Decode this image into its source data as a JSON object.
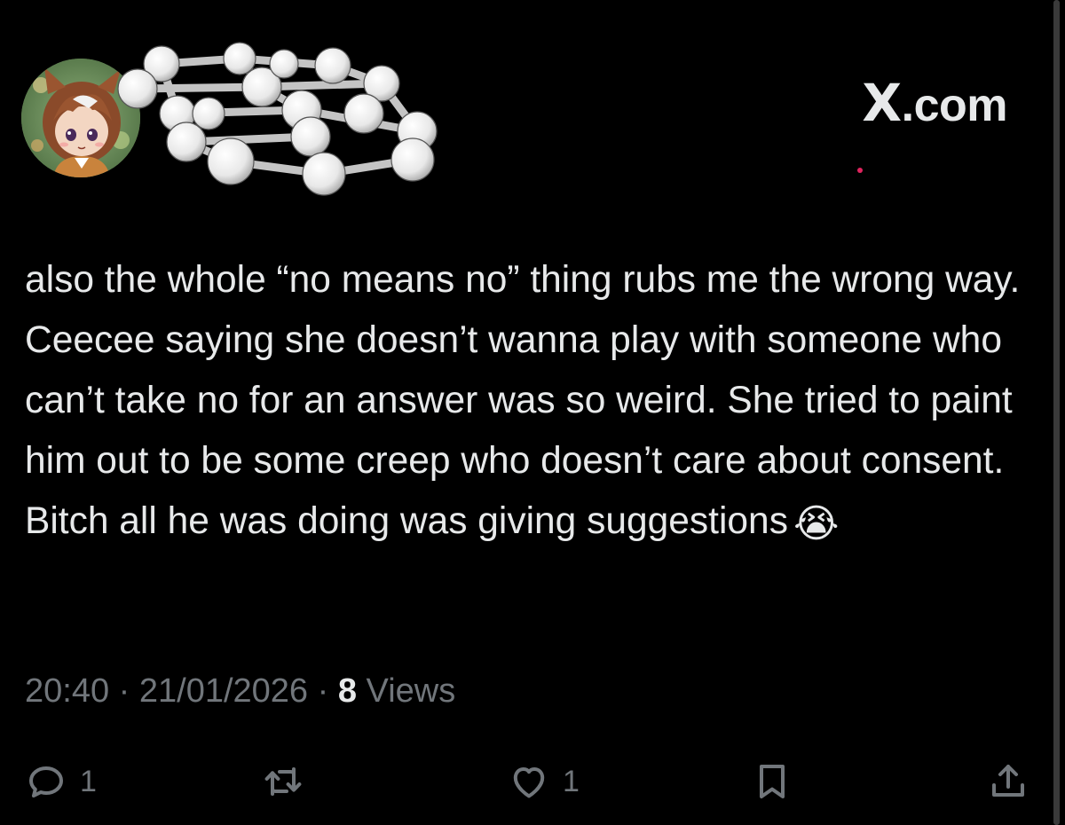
{
  "header": {
    "brand": "X.com"
  },
  "tweet": {
    "text": "also the whole “no means no” thing rubs me the wrong way. Ceecee saying she doesn’t wanna play with someone who can’t take no for an answer was so weird. She tried to paint him out to be some creep who doesn’t care about consent. Bitch all he was doing was giving suggestions",
    "emoji": "😭",
    "time": "20:40",
    "separator": "·",
    "date": "21/01/2026",
    "views_count": "8",
    "views_label": "Views"
  },
  "actions": {
    "reply_count": "1",
    "like_count": "1"
  },
  "icons": {
    "reply": "reply-icon",
    "retweet": "retweet-icon",
    "like": "heart-icon",
    "bookmark": "bookmark-icon",
    "share": "share-icon"
  },
  "colors": {
    "background": "#000000",
    "text": "#e7e9ea",
    "muted": "#71767b",
    "notification_dot": "#e0245e"
  }
}
